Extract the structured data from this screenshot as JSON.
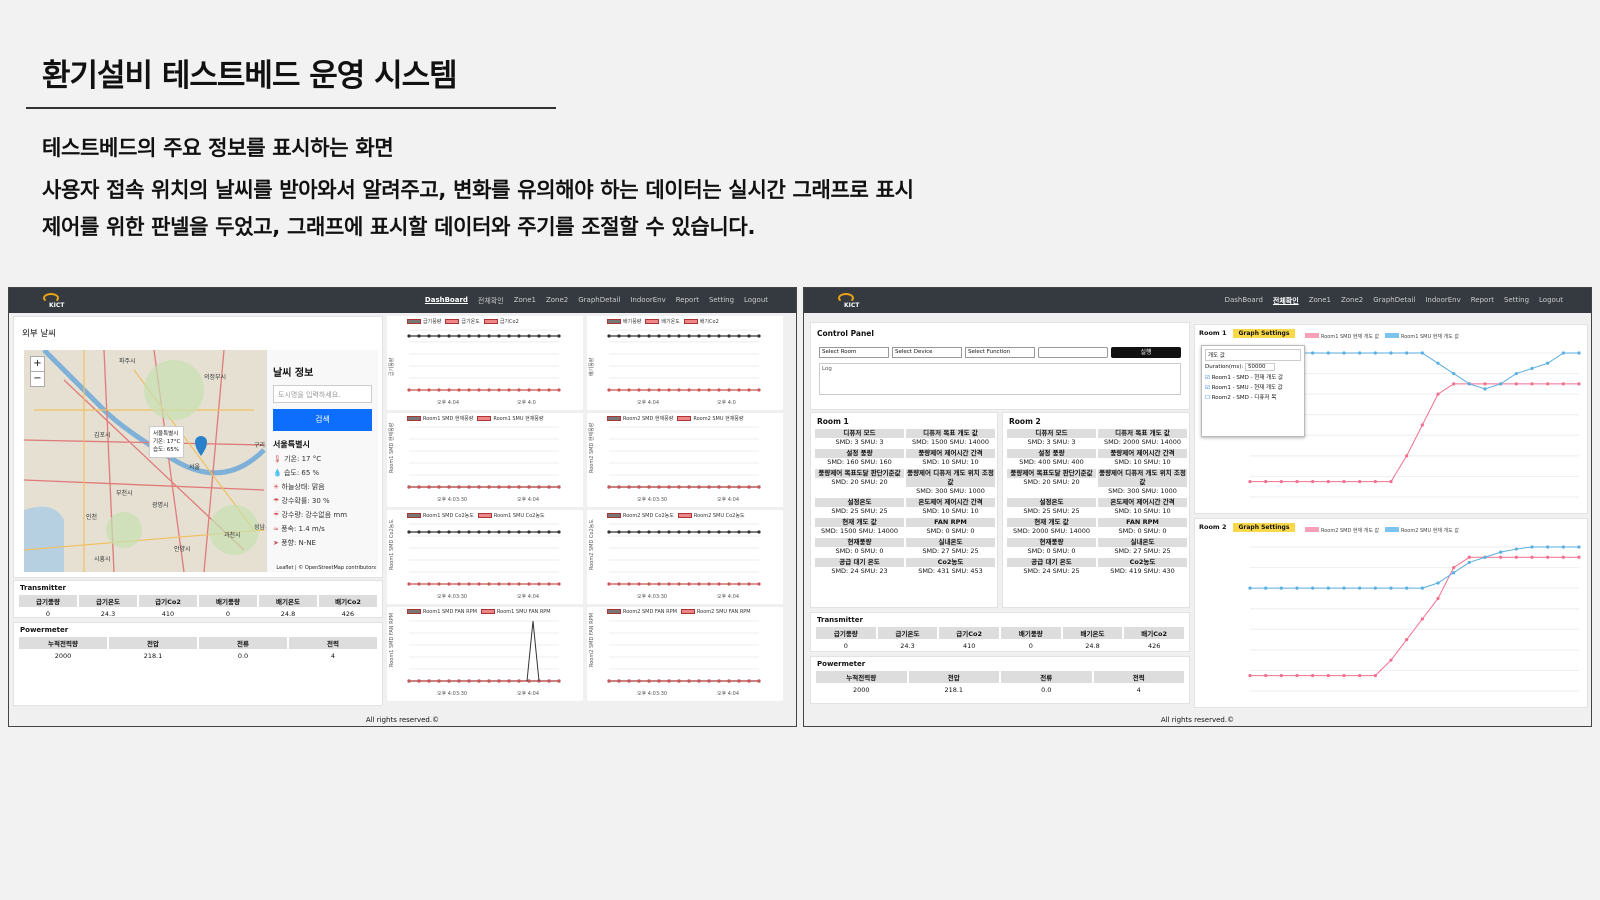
{
  "slide": {
    "title": "환기설비 테스트베드 운영 시스템",
    "line1": "테스트베드의 주요 정보를 표시하는 화면",
    "line2": "사용자 접속 위치의 날씨를 받아와서 알려주고, 변화를 유의해야 하는 데이터는 실시간 그래프로 표시",
    "line3": "제어를 위한 판넬을 두었고, 그래프에 표시할 데이터와 주기를 조절할 수 있습니다."
  },
  "left": {
    "logo": "KICT",
    "nav": [
      "DashBoard",
      "전체확인",
      "Zone1",
      "Zone2",
      "GraphDetail",
      "IndoorEnv",
      "Report",
      "Setting",
      "Logout"
    ],
    "weather_card_title": "외부 날씨",
    "map": {
      "zoom_in": "+",
      "zoom_out": "−",
      "popup": "서울특별시\n기온: 17°C\n습도: 65%",
      "labels": [
        "파주시",
        "의정부시",
        "남양주시",
        "김포시",
        "서울",
        "부천시",
        "인천",
        "광명시",
        "과천시",
        "시흥시",
        "안양시",
        "성남시",
        "하남시",
        "구리시"
      ],
      "attribution": "Leaflet | © OpenStreetMap contributors"
    },
    "weather": {
      "title": "날씨 정보",
      "placeholder": "도시명을 입력하세요.",
      "search": "검색",
      "city": "서울특별시",
      "rows": [
        "기온: 17 °C",
        "습도: 65 %",
        "하늘상태: 맑음",
        "강수확률: 30 %",
        "강수량: 강수없음 mm",
        "풍속: 1.4 m/s",
        "풍향: N-NE"
      ]
    },
    "transmitter": {
      "title": "Transmitter",
      "headers": [
        "급기풍량",
        "급기온도",
        "급기Co2",
        "배기풍량",
        "배기온도",
        "배기Co2"
      ],
      "values": [
        "0",
        "24.3",
        "410",
        "0",
        "24.8",
        "426"
      ]
    },
    "powermeter": {
      "title": "Powermeter",
      "headers": [
        "누적전력량",
        "전압",
        "전류",
        "전력"
      ],
      "values": [
        "2000",
        "218.1",
        "0.0",
        "4"
      ]
    },
    "charts": [
      {
        "legend": [
          "급기풍량",
          "급기온도",
          "급기Co2"
        ],
        "xlabels": [
          "오후 4:04",
          "오후 4:0"
        ],
        "yl": "급기풍량"
      },
      {
        "legend": [
          "배기풍량",
          "배기온도",
          "배기Co2"
        ],
        "xlabels": [
          "오후 4:04",
          "오후 4:0"
        ],
        "yl": "배기풍량"
      },
      {
        "legend": [
          "Room1 SMD 현재풍량",
          "Room1 SMU 현재풍량"
        ],
        "xlabels": [
          "오후 4:03:30",
          "오후 4:04"
        ],
        "yl": "Room1 SMD 현재풍량"
      },
      {
        "legend": [
          "Room2 SMD 현재풍량",
          "Room2 SMU 현재풍량"
        ],
        "xlabels": [
          "오후 4:03:30",
          "오후 4:04"
        ],
        "yl": "Room2 SMD 현재풍량"
      },
      {
        "legend": [
          "Room1 SMD Co2농도",
          "Room1 SMU Co2농도"
        ],
        "xlabels": [
          "오후 4:03:30",
          "오후 4:04"
        ],
        "yl": "Room1 SMD Co2농도"
      },
      {
        "legend": [
          "Room2 SMD Co2농도",
          "Room2 SMU Co2농도"
        ],
        "xlabels": [
          "오후 4:03:30",
          "오후 4:04"
        ],
        "yl": "Room2 SMD Co2농도"
      },
      {
        "legend": [
          "Room1 SMD FAN RPM",
          "Room1 SMU FAN RPM"
        ],
        "xlabels": [
          "오후 4:03:30",
          "오후 4:04"
        ],
        "yl": "Room1 SMD FAN RPM"
      },
      {
        "legend": [
          "Room2 SMD FAN RPM",
          "Room2 SMU FAN RPM"
        ],
        "xlabels": [
          "오후 4:03:30",
          "오후 4:04"
        ],
        "yl": "Room2 SMD FAN RPM"
      }
    ],
    "footer": "All rights reserved.©"
  },
  "right": {
    "logo": "KICT",
    "nav": [
      "DashBoard",
      "전체확인",
      "Zone1",
      "Zone2",
      "GraphDetail",
      "IndoorEnv",
      "Report",
      "Setting",
      "Logout"
    ],
    "control": {
      "title": "Control Panel",
      "room": "Select Room",
      "device": "Select Device",
      "function": "Select Function",
      "run": "실행",
      "log": "Log"
    },
    "room1": {
      "title": "Room 1",
      "cells": [
        [
          "디퓨저 모드",
          "SMD: 3 SMU: 3"
        ],
        [
          "디퓨저 목표 개도 값",
          "SMD: 1500 SMU: 14000"
        ],
        [
          "설정 풍량",
          "SMD: 160 SMU: 160"
        ],
        [
          "풍량제어 제어시간 간격",
          "SMD: 10 SMU: 10"
        ],
        [
          "풍량제어 목표도달 판단기준값",
          "SMD: 20 SMU: 20"
        ],
        [
          "풍량제어 디퓨저 개도 위치 조정값",
          "SMD: 300 SMU: 1000"
        ],
        [
          "설정온도",
          "SMD: 25 SMU: 25"
        ],
        [
          "온도제어 제어시간 간격",
          "SMD: 10 SMU: 10"
        ],
        [
          "현재 개도 값",
          "SMD: 1500 SMU: 14000"
        ],
        [
          "FAN RPM",
          "SMD: 0 SMU: 0"
        ],
        [
          "현재풍량",
          "SMD: 0 SMU: 0"
        ],
        [
          "실내온도",
          "SMD: 27 SMU: 25"
        ],
        [
          "공급 대기 온도",
          "SMD: 24 SMU: 23"
        ],
        [
          "Co2농도",
          "SMD: 431 SMU: 453"
        ]
      ]
    },
    "room2": {
      "title": "Room 2",
      "cells": [
        [
          "디퓨저 모드",
          "SMD: 3 SMU: 3"
        ],
        [
          "디퓨저 목표 개도 값",
          "SMD: 2000 SMU: 14000"
        ],
        [
          "설정 풍량",
          "SMD: 400 SMU: 400"
        ],
        [
          "풍량제어 제어시간 간격",
          "SMD: 10 SMU: 10"
        ],
        [
          "풍량제어 목표도달 판단기준값",
          "SMD: 20 SMU: 20"
        ],
        [
          "풍량제어 디퓨저 개도 위치 조정값",
          "SMD: 300 SMU: 1000"
        ],
        [
          "설정온도",
          "SMD: 25 SMU: 25"
        ],
        [
          "온도제어 제어시간 간격",
          "SMD: 10 SMU: 10"
        ],
        [
          "현재 개도 값",
          "SMD: 2000 SMU: 14000"
        ],
        [
          "FAN RPM",
          "SMD: 0 SMU: 0"
        ],
        [
          "현재풍량",
          "SMD: 0 SMU: 0"
        ],
        [
          "실내온도",
          "SMD: 27 SMU: 25"
        ],
        [
          "공급 대기 온도",
          "SMD: 24 SMU: 25"
        ],
        [
          "Co2농도",
          "SMD: 419 SMU: 430"
        ]
      ]
    },
    "transmitter": {
      "title": "Transmitter",
      "headers": [
        "급기풍량",
        "급기온도",
        "급기Co2",
        "배기풍량",
        "배기온도",
        "배기Co2"
      ],
      "values": [
        "0",
        "24.3",
        "410",
        "0",
        "24.8",
        "426"
      ]
    },
    "powermeter": {
      "title": "Powermeter",
      "headers": [
        "누적전력량",
        "전압",
        "전류",
        "전력"
      ],
      "values": [
        "2000",
        "218.1",
        "0.0",
        "4"
      ]
    },
    "graph1": {
      "title": "Room 1",
      "settings": "Graph Settings",
      "legend": [
        "Room1 SMD 현재 개도 값",
        "Room1 SMU 현재 개도 값"
      ],
      "popup": {
        "label": "개도 값",
        "duration_label": "Duration(ms):",
        "duration": "50000",
        "opts": [
          "Room1 - SMD - 현재 개도 값",
          "Room1 - SMU - 현재 개도 값",
          "Room2 - SMD - 디퓨저 목"
        ]
      }
    },
    "graph2": {
      "title": "Room 2",
      "settings": "Graph Settings",
      "legend": [
        "Room2 SMD 현재 개도 값",
        "Room2 SMU 현재 개도 값"
      ]
    },
    "footer": "All rights reserved.©"
  },
  "chart_data": [
    {
      "type": "line",
      "series": [
        {
          "name": "Room1 SMD 현재 개도 값",
          "values": [
            1500,
            1500,
            1500,
            1500,
            1500,
            1500,
            1500,
            1500,
            1500,
            1500,
            4000,
            7000,
            10000,
            11000,
            11000,
            11000,
            11000,
            11000,
            11000,
            11000,
            11000,
            11000
          ]
        },
        {
          "name": "Room1 SMU 현재 개도 값",
          "values": [
            14000,
            14000,
            14000,
            14000,
            14000,
            14000,
            14000,
            14000,
            14000,
            14000,
            14000,
            14000,
            13000,
            12000,
            11000,
            10500,
            11000,
            12000,
            12500,
            13000,
            14000,
            14000
          ]
        }
      ]
    },
    {
      "type": "line",
      "series": [
        {
          "name": "Room2 SMD 현재 개도 값",
          "values": [
            1500,
            1500,
            1500,
            1500,
            1500,
            1500,
            1500,
            1500,
            1500,
            3000,
            5000,
            7000,
            9000,
            12000,
            13000,
            13000,
            13000,
            13000,
            13000,
            13000,
            13000,
            13000
          ]
        },
        {
          "name": "Room2 SMU 현재 개도 값",
          "values": [
            10000,
            10000,
            10000,
            10000,
            10000,
            10000,
            10000,
            10000,
            10000,
            10000,
            10000,
            10000,
            10500,
            11500,
            12500,
            13000,
            13500,
            13800,
            14000,
            14000,
            14000,
            14000
          ]
        }
      ]
    }
  ]
}
